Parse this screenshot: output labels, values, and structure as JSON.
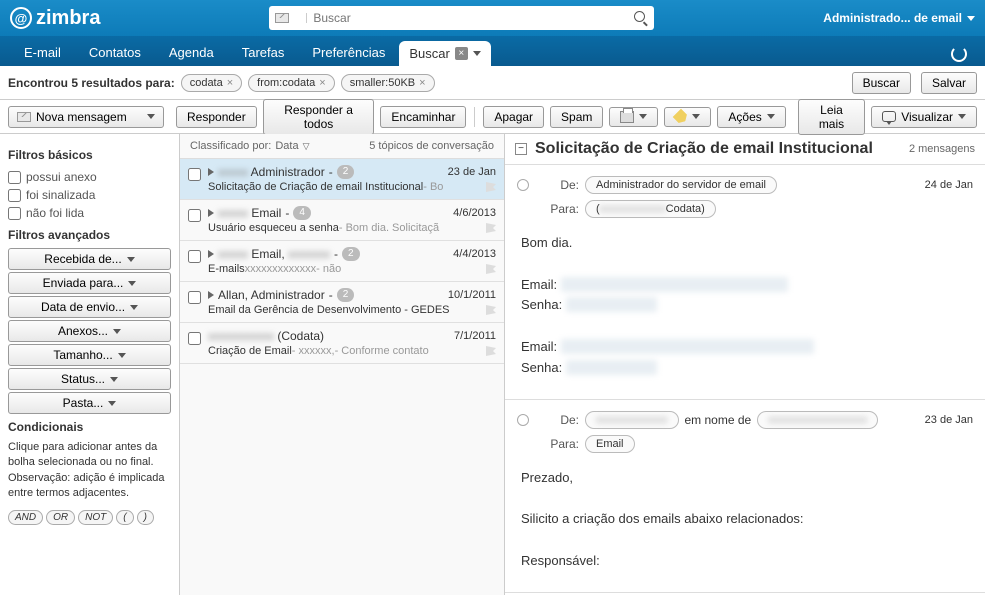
{
  "brand": "zimbra",
  "search": {
    "placeholder": "Buscar"
  },
  "user_menu": "Administrado... de email",
  "nav": {
    "email": "E-mail",
    "contatos": "Contatos",
    "agenda": "Agenda",
    "tarefas": "Tarefas",
    "preferencias": "Preferências",
    "buscar": "Buscar"
  },
  "results": {
    "label": "Encontrou 5 resultados para:",
    "chips": [
      "codata",
      "from:codata",
      "smaller:50KB"
    ],
    "buscar": "Buscar",
    "salvar": "Salvar"
  },
  "toolbar": {
    "nova": "Nova mensagem",
    "responder": "Responder",
    "responder_todos": "Responder a todos",
    "encaminhar": "Encaminhar",
    "apagar": "Apagar",
    "spam": "Spam",
    "acoes": "Ações",
    "leia_mais": "Leia mais",
    "visualizar": "Visualizar"
  },
  "filters": {
    "basic_head": "Filtros básicos",
    "anexo": "possui anexo",
    "sinalizada": "foi sinalizada",
    "nao_lida": "não foi lida",
    "adv_head": "Filtros avançados",
    "recebida": "Recebida de...",
    "enviada": "Enviada para...",
    "data": "Data de envio...",
    "anexos": "Anexos...",
    "tamanho": "Tamanho...",
    "status": "Status...",
    "pasta": "Pasta...",
    "cond_head": "Condicionais",
    "cond_text": "Clique para adicionar antes da bolha selecionada ou no final. Observação: adição é implicada entre termos adjacentes.",
    "ops": [
      "AND",
      "OR",
      "NOT",
      "(",
      ")"
    ]
  },
  "list": {
    "sort_label": "Classificado por:",
    "sort_value": "Data",
    "topics": "5 tópicos de conversação",
    "items": [
      {
        "sender": "Administrador",
        "count": "2",
        "date": "23 de Jan",
        "subject": "Solicitação de Criação de email Institucional",
        "preview": " - Bo"
      },
      {
        "sender": "Email",
        "count": "4",
        "date": "4/6/2013",
        "subject": "Usuário esqueceu a senha",
        "preview": " - Bom dia. Solicitaçã"
      },
      {
        "sender": "Email, ",
        "count": "2",
        "date": "4/4/2013",
        "subject": "E-mails ",
        "preview": " - não"
      },
      {
        "sender": "Allan, Administrador",
        "count": "2",
        "date": "10/1/2011",
        "subject": "Email da Gerência de Desenvolvimento - GEDES",
        "preview": ""
      },
      {
        "sender": "(Codata)",
        "count": "",
        "date": "7/1/2011",
        "subject": "Criação de Email",
        "preview": " - Conforme contato"
      }
    ]
  },
  "reading": {
    "title": "Solicitação de Criação de email Institucional",
    "count": "2 mensagens",
    "msg1": {
      "de_label": "De:",
      "de": "Administrador do servidor de email",
      "para_label": "Para:",
      "para_tail": "Codata)",
      "date": "24 de Jan",
      "body_greet": "Bom dia.",
      "l1": "Email:",
      "l2": "Senha:",
      "l3": "Email:",
      "l4": "Senha:"
    },
    "msg2": {
      "de_label": "De:",
      "em_nome": "em nome de",
      "para_label": "Para:",
      "para": "Email",
      "date": "23 de Jan",
      "p1": "Prezado,",
      "p2": "Silicito a criação dos emails abaixo relacionados:",
      "p3": "Responsável:"
    }
  }
}
